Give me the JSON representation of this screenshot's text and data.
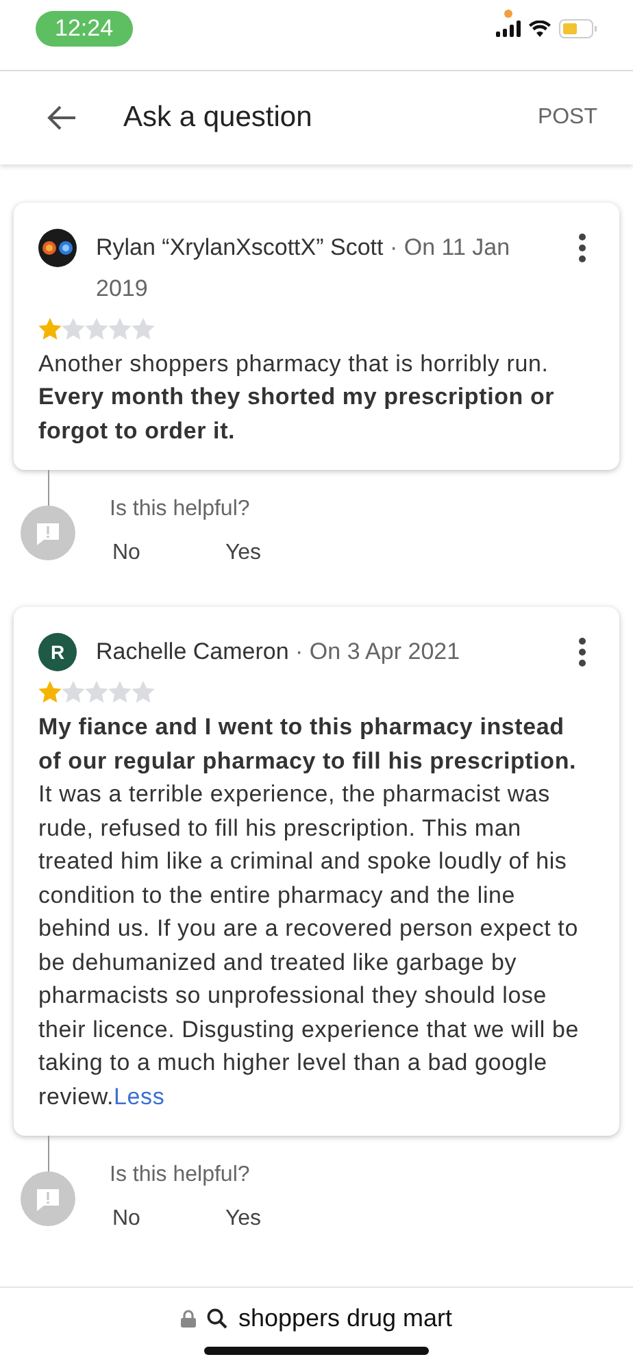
{
  "status_bar": {
    "time": "12:24"
  },
  "header": {
    "title": "Ask a question",
    "action": "POST"
  },
  "reviews": [
    {
      "author": "Rylan “XrylanXscottX” Scott",
      "date": "· On 11 Jan 2019",
      "stars": 1,
      "text": "Another shoppers pharmacy that is horribly run. **Every month they shorted my prescription or forgot to order it.**",
      "helpful": {
        "question": "Is this helpful?",
        "no": "No",
        "yes": "Yes"
      }
    },
    {
      "author": "Rachelle Cameron",
      "date": "· On 3 Apr 2021",
      "avatar": {
        "kind": "letter",
        "letter": "R",
        "color": "#1e5a45"
      },
      "stars": 1,
      "text": "**My fiance and I went to this pharmacy instead of our regular pharmacy to fill his prescription.** It was a terrible experience, the pharmacist was rude, refused to fill his prescription. This man treated him like a criminal and spoke loudly of his condition to the entire pharmacy and the line behind us. If you are a recovered person expect to be dehumanized and treated like garbage by pharmacists so unprofessional they should lose their licence. Disgusting experience that we will be taking to a much higher level than a bad google review.",
      "less": "Less",
      "helpful": {
        "question": "Is this helpful?",
        "no": "No",
        "yes": "Yes"
      }
    }
  ],
  "address_bar": {
    "text": "shoppers drug mart"
  }
}
